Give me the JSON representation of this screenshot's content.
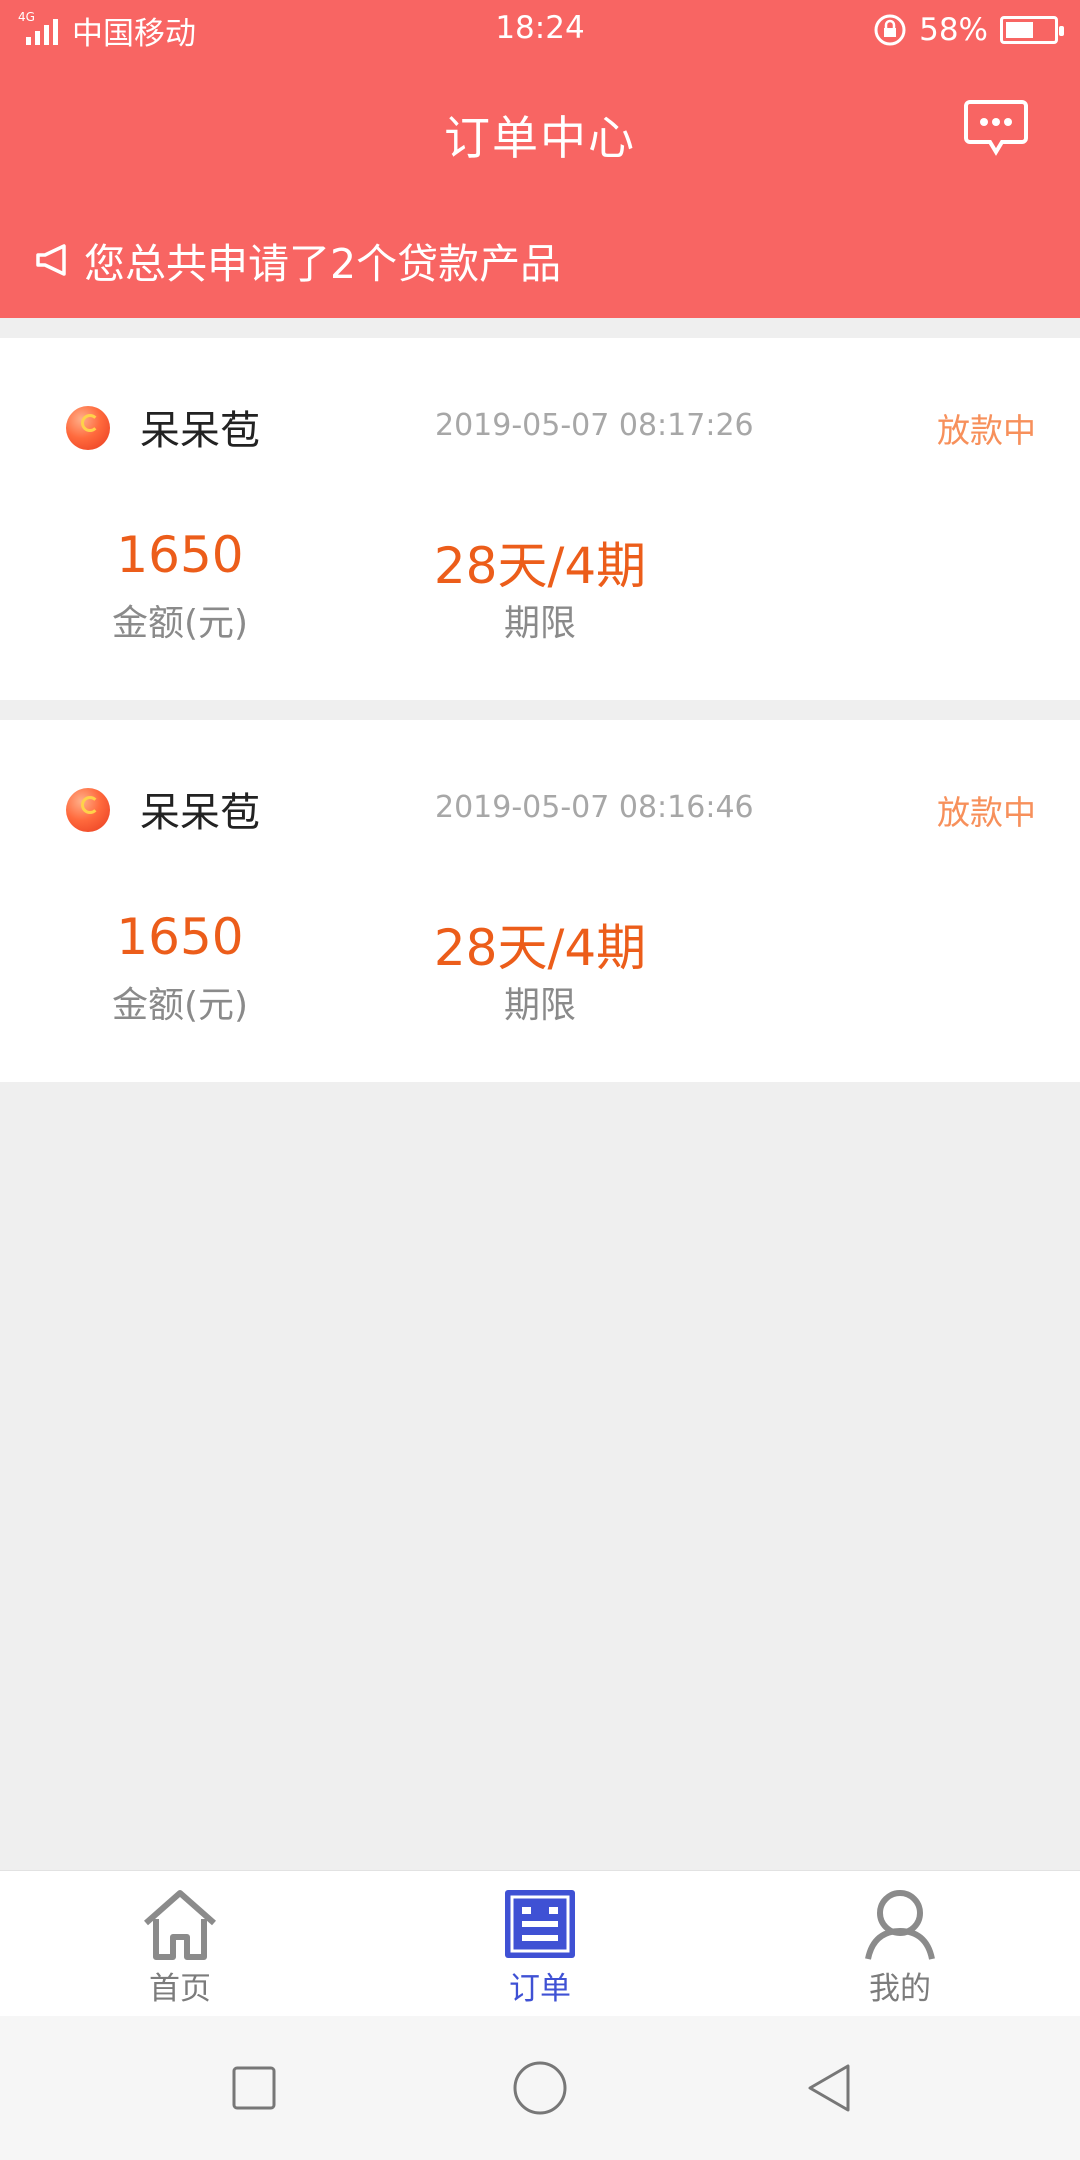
{
  "status_bar": {
    "network_tag": "4G",
    "carrier": "中国移动",
    "time": "18:24",
    "battery": "58%",
    "battery_level": 0.58
  },
  "header": {
    "title": "订单中心",
    "notice": "您总共申请了2个贷款产品"
  },
  "orders": [
    {
      "product": "呆呆苞",
      "time": "2019-05-07 08:17:26",
      "status": "放款中",
      "amount": "1650",
      "amount_label": "金额(元)",
      "term": "28天/4期",
      "term_label": "期限"
    },
    {
      "product": "呆呆苞",
      "time": "2019-05-07 08:16:46",
      "status": "放款中",
      "amount": "1650",
      "amount_label": "金额(元)",
      "term": "28天/4期",
      "term_label": "期限"
    }
  ],
  "tab_bar": {
    "items": [
      {
        "label": "首页",
        "icon": "home-icon",
        "active": false
      },
      {
        "label": "订单",
        "icon": "order-icon",
        "active": true
      },
      {
        "label": "我的",
        "icon": "profile-icon",
        "active": false
      }
    ]
  },
  "colors": {
    "header_bg": "#f86563",
    "accent_orange": "#ec5d1a",
    "status_orange": "#f7905b",
    "tab_active": "#3f51d4",
    "tab_inactive": "#7c7c7c"
  }
}
